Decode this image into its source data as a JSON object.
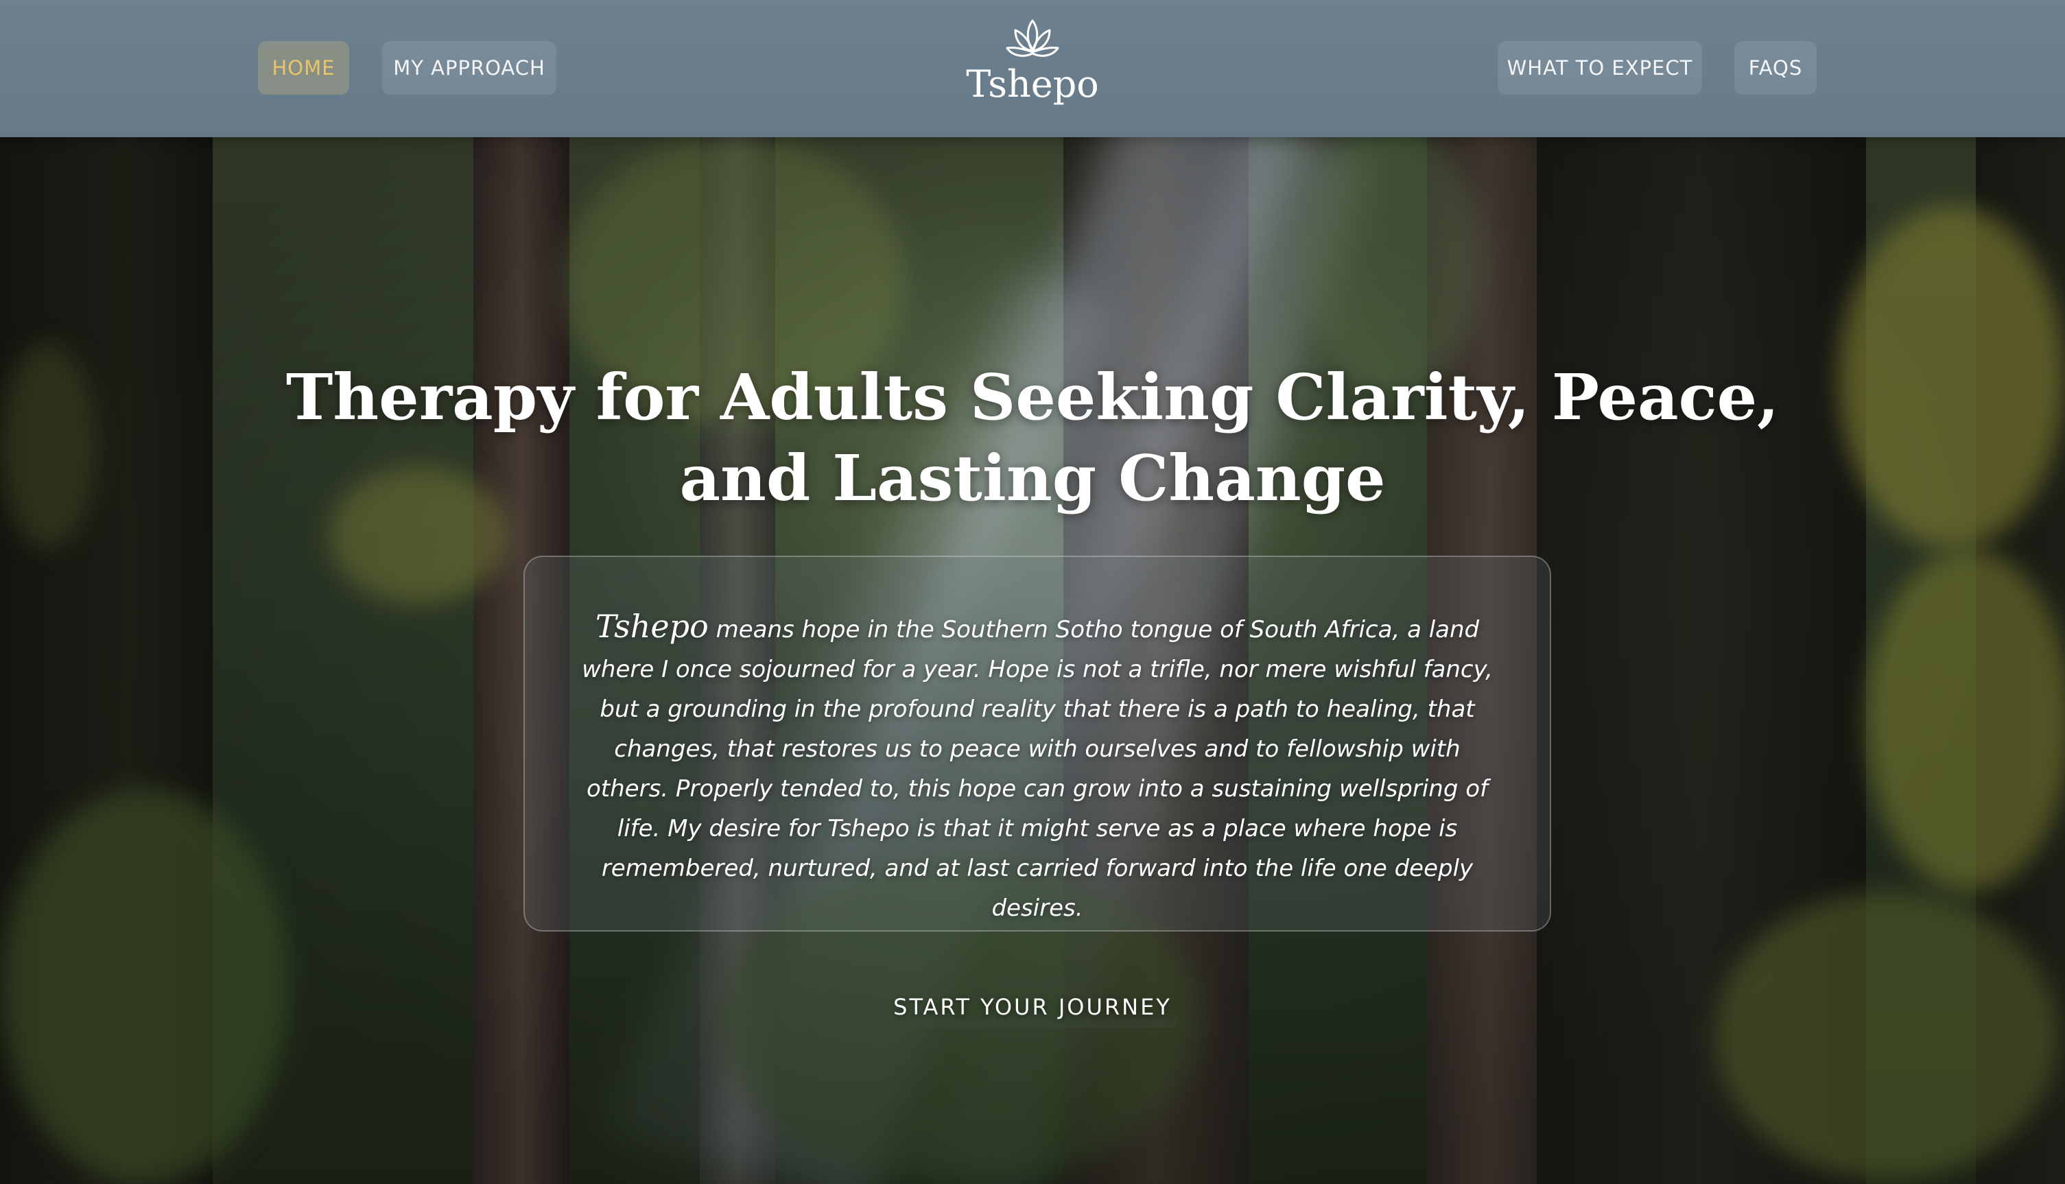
{
  "nav": {
    "left": [
      {
        "label": "HOME",
        "active": true
      },
      {
        "label": "MY APPROACH",
        "active": false
      }
    ],
    "right": [
      {
        "label": "WHAT TO EXPECT",
        "active": false
      },
      {
        "label": "FAQS",
        "active": false
      }
    ],
    "logo": {
      "icon": "lotus-icon",
      "text": "Tshepo"
    }
  },
  "hero": {
    "title": "Therapy for Adults Seeking Clarity, Peace, and Lasting Change",
    "quote": {
      "name": "Tshepo",
      "text": " means hope in the Southern Sotho tongue of South Africa, a land where I once sojourned for a year. Hope is not a trifle, nor mere wishful fancy, but a grounding in the profound reality that there is a path to healing, that changes, that restores us to peace with ourselves and to fellowship with others. Properly tended to, this hope can grow into a sustaining wellspring of life. My desire for Tshepo is that it might serve as a place where hope is remembered, nurtured, and at last carried forward into the life one deeply desires."
    },
    "cta_label": "START YOUR JOURNEY"
  },
  "colors": {
    "header_bg": "#6a7e8e",
    "active_nav_text": "#e8c56a",
    "text": "#ffffff"
  }
}
